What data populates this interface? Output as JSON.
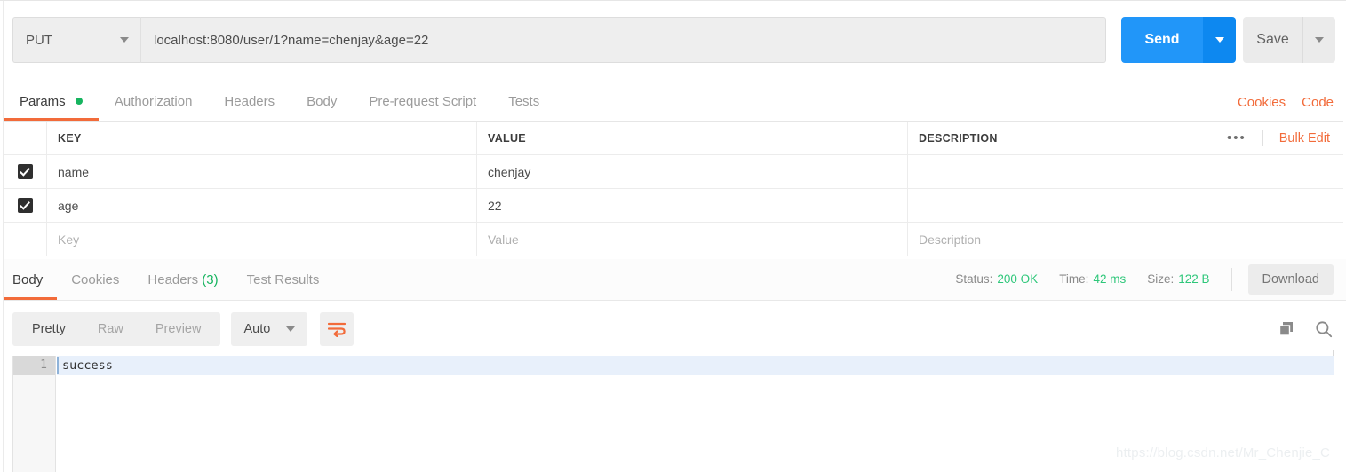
{
  "request": {
    "method": "PUT",
    "url": "localhost:8080/user/1?name=chenjay&age=22",
    "send_label": "Send",
    "save_label": "Save",
    "tabs": [
      {
        "label": "Params",
        "active": true,
        "dot": true
      },
      {
        "label": "Authorization",
        "active": false,
        "dot": false
      },
      {
        "label": "Headers",
        "active": false,
        "dot": false
      },
      {
        "label": "Body",
        "active": false,
        "dot": false
      },
      {
        "label": "Pre-request Script",
        "active": false,
        "dot": false
      },
      {
        "label": "Tests",
        "active": false,
        "dot": false
      }
    ],
    "cookies_link": "Cookies",
    "code_link": "Code"
  },
  "params": {
    "headers": {
      "key": "KEY",
      "value": "VALUE",
      "description": "DESCRIPTION"
    },
    "dots": "•••",
    "bulk_edit": "Bulk Edit",
    "rows": [
      {
        "checked": true,
        "key": "name",
        "value": "chenjay",
        "description": ""
      },
      {
        "checked": true,
        "key": "age",
        "value": "22",
        "description": ""
      }
    ],
    "new_row": {
      "key_placeholder": "Key",
      "value_placeholder": "Value",
      "description_placeholder": "Description"
    }
  },
  "response": {
    "tabs": [
      {
        "label": "Body",
        "count": "",
        "active": true
      },
      {
        "label": "Cookies",
        "count": "",
        "active": false
      },
      {
        "label": "Headers",
        "count": "(3)",
        "active": false
      },
      {
        "label": "Test Results",
        "count": "",
        "active": false
      }
    ],
    "meta": {
      "status_label": "Status:",
      "status_value": "200 OK",
      "time_label": "Time:",
      "time_value": "42 ms",
      "size_label": "Size:",
      "size_value": "122 B"
    },
    "download_label": "Download",
    "viewer": {
      "modes": [
        {
          "label": "Pretty",
          "active": true
        },
        {
          "label": "Raw",
          "active": false
        },
        {
          "label": "Preview",
          "active": false
        }
      ],
      "format": "Auto",
      "wrap_icon": "word-wrap-icon",
      "copy_icon": "copy-icon",
      "search_icon": "search-icon"
    },
    "body": {
      "line_number": "1",
      "text": "success"
    }
  },
  "watermark": "https://blog.csdn.net/Mr_Chenjie_C",
  "colors": {
    "accent_orange": "#f26b3a",
    "send_blue": "#2196f9",
    "success_green": "#16b45f",
    "status_green": "#2ec77a"
  }
}
